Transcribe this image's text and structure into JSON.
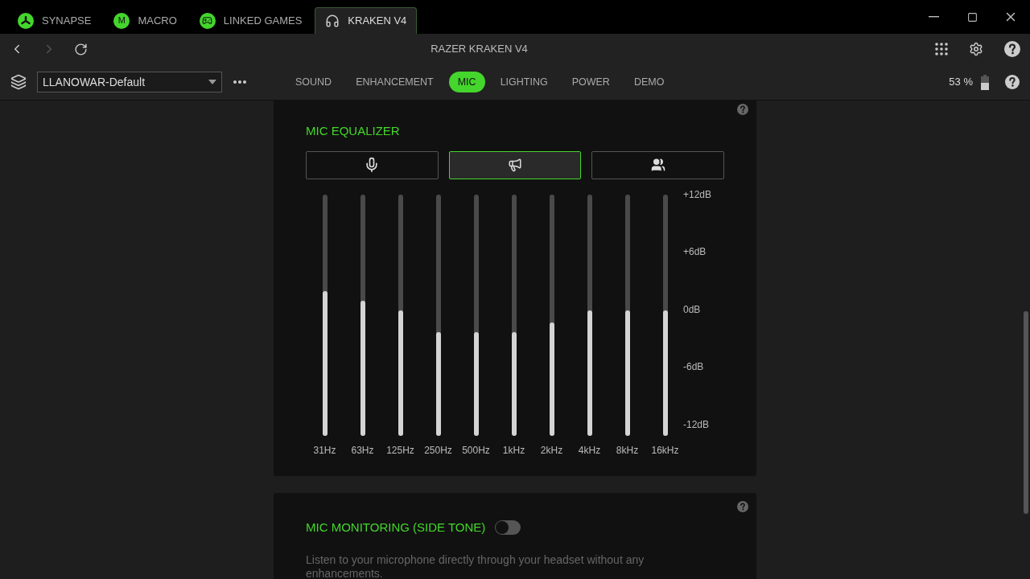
{
  "app_tabs": [
    {
      "label": "SYNAPSE",
      "kind": "synapse",
      "selected": false
    },
    {
      "label": "MACRO",
      "kind": "macro",
      "badge": "M",
      "selected": false
    },
    {
      "label": "LINKED GAMES",
      "kind": "games",
      "selected": false
    },
    {
      "label": "KRAKEN V4",
      "kind": "headset",
      "selected": true
    }
  ],
  "window": {
    "title": "RAZER KRAKEN V4"
  },
  "profile": {
    "value": "LLANOWAR-Default"
  },
  "device_tabs": [
    {
      "label": "SOUND",
      "selected": false
    },
    {
      "label": "ENHANCEMENT",
      "selected": false
    },
    {
      "label": "MIC",
      "selected": true
    },
    {
      "label": "LIGHTING",
      "selected": false
    },
    {
      "label": "POWER",
      "selected": false
    },
    {
      "label": "DEMO",
      "selected": false
    }
  ],
  "battery": {
    "reading": "53 %"
  },
  "equalizer": {
    "title": "MIC EQUALIZER",
    "presets": [
      {
        "kind": "microphone",
        "selected": false
      },
      {
        "kind": "megaphone",
        "selected": true
      },
      {
        "kind": "people",
        "selected": false
      }
    ],
    "bands": [
      {
        "label": "31Hz",
        "level": 0.6
      },
      {
        "label": "63Hz",
        "level": 0.56
      },
      {
        "label": "125Hz",
        "level": 0.52
      },
      {
        "label": "250Hz",
        "level": 0.43
      },
      {
        "label": "500Hz",
        "level": 0.43
      },
      {
        "label": "1kHz",
        "level": 0.43
      },
      {
        "label": "2kHz",
        "level": 0.47
      },
      {
        "label": "4kHz",
        "level": 0.52
      },
      {
        "label": "8kHz",
        "level": 0.52
      },
      {
        "label": "16kHz",
        "level": 0.52
      }
    ],
    "scale": [
      "+12dB",
      "+6dB",
      "0dB",
      "-6dB",
      "-12dB"
    ]
  },
  "monitoring": {
    "title": "MIC MONITORING (SIDE TONE)",
    "on": false,
    "description": "Listen to your microphone directly through your headset without any enhancements."
  }
}
